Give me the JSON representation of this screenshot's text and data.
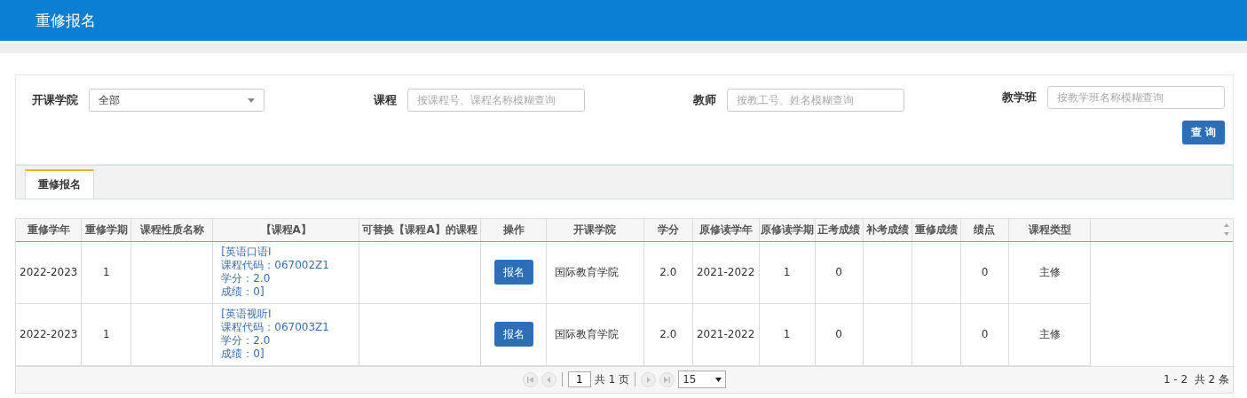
{
  "header": {
    "title": "重修报名"
  },
  "filters": [
    {
      "label": "开课学院",
      "kind": "select",
      "value": "全部"
    },
    {
      "label": "课程",
      "kind": "input",
      "placeholder": "按课程号、课程名称模糊查询"
    },
    {
      "label": "教师",
      "kind": "input",
      "placeholder": "按教工号、姓名模糊查询"
    },
    {
      "label": "教学班",
      "kind": "input",
      "placeholder": "按教学班名称模糊查询"
    }
  ],
  "search_button": "查 询",
  "tabs": [
    {
      "label": "重修报名",
      "selected": true
    }
  ],
  "table": {
    "columns": [
      "重修学年",
      "重修学期",
      "课程性质名称",
      "【课程A】",
      "可替换【课程A】的课程",
      "操作",
      "开课学院",
      "学分",
      "原修读学年",
      "原修读学期",
      "正考成绩",
      "补考成绩",
      "重修成绩",
      "绩点",
      "课程类型"
    ],
    "rows": [
      {
        "cells": [
          {
            "kind": "text",
            "text": "2022-2023"
          },
          {
            "kind": "text",
            "text": "1"
          },
          {
            "kind": "empty"
          },
          {
            "kind": "lines",
            "lines": [
              "[英语口语Ⅰ",
              "课程代码：067002Z1",
              "学分：2.0",
              "成绩：0]"
            ]
          },
          {
            "kind": "empty"
          },
          {
            "kind": "button",
            "text": "报名"
          },
          {
            "kind": "left_text",
            "text": "国际教育学院"
          },
          {
            "kind": "text",
            "text": "2.0"
          },
          {
            "kind": "text",
            "text": "2021-2022"
          },
          {
            "kind": "text",
            "text": "1"
          },
          {
            "kind": "text",
            "text": "0"
          },
          {
            "kind": "empty"
          },
          {
            "kind": "empty"
          },
          {
            "kind": "text",
            "text": "0"
          },
          {
            "kind": "text",
            "text": "主修"
          }
        ]
      },
      {
        "cells": [
          {
            "kind": "text",
            "text": "2022-2023"
          },
          {
            "kind": "text",
            "text": "1"
          },
          {
            "kind": "empty"
          },
          {
            "kind": "lines",
            "lines": [
              "[英语视听Ⅰ",
              "课程代码：067003Z1",
              "学分：2.0",
              "成绩：0]"
            ]
          },
          {
            "kind": "empty"
          },
          {
            "kind": "button",
            "text": "报名"
          },
          {
            "kind": "left_text",
            "text": "国际教育学院"
          },
          {
            "kind": "text",
            "text": "2.0"
          },
          {
            "kind": "text",
            "text": "2021-2022"
          },
          {
            "kind": "text",
            "text": "1"
          },
          {
            "kind": "text",
            "text": "0"
          },
          {
            "kind": "empty"
          },
          {
            "kind": "empty"
          },
          {
            "kind": "text",
            "text": "0"
          },
          {
            "kind": "text",
            "text": "主修"
          }
        ]
      }
    ]
  },
  "pager": {
    "page": "1",
    "total_pages": "共 1 页",
    "page_size": "15",
    "summary": "1 - 2  共 2 条"
  }
}
